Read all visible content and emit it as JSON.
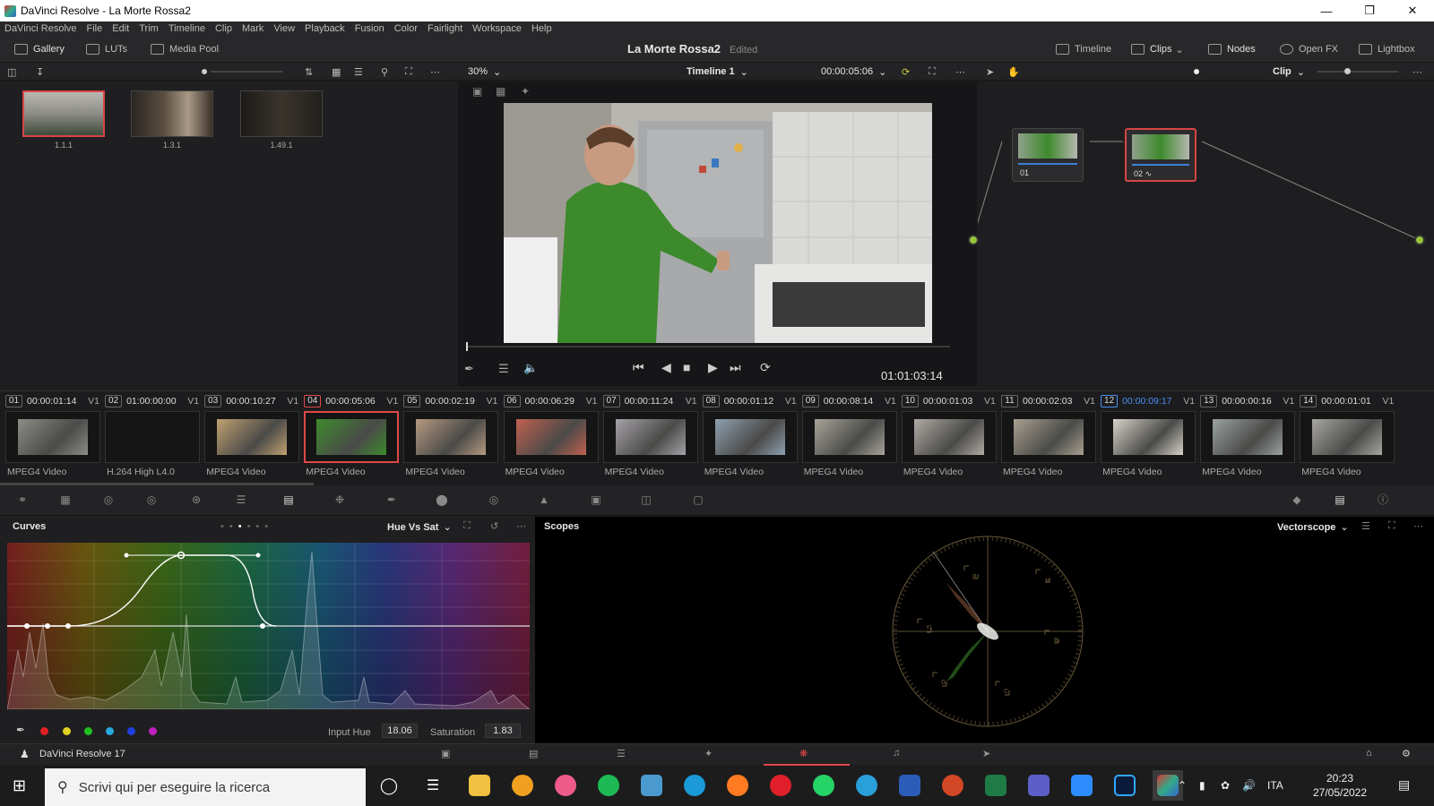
{
  "window": {
    "title": "DaVinci Resolve - La Morte Rossa2"
  },
  "menu": [
    "DaVinci Resolve",
    "File",
    "Edit",
    "Trim",
    "Timeline",
    "Clip",
    "Mark",
    "View",
    "Playback",
    "Fusion",
    "Color",
    "Fairlight",
    "Workspace",
    "Help"
  ],
  "toolbar": {
    "gallery": "Gallery",
    "luts": "LUTs",
    "media_pool": "Media Pool",
    "project_name": "La Morte Rossa2",
    "edited": "Edited",
    "timeline": "Timeline",
    "clips": "Clips",
    "nodes": "Nodes",
    "openfx": "Open FX",
    "lightbox": "Lightbox"
  },
  "viewer": {
    "zoom": "30%",
    "timeline_name": "Timeline 1",
    "timecode_top": "00:00:05:06",
    "timecode_main": "01:01:03:14",
    "node_mode": "Clip"
  },
  "gallery": {
    "stills": [
      {
        "label": "1.1.1",
        "selected": true
      },
      {
        "label": "1.3.1",
        "selected": false
      },
      {
        "label": "1.49.1",
        "selected": false
      }
    ]
  },
  "nodes": [
    {
      "label": "01"
    },
    {
      "label": "02"
    }
  ],
  "clips": [
    {
      "num": "01",
      "tc": "00:00:01:14",
      "track": "V1",
      "fmt": "MPEG4 Video"
    },
    {
      "num": "02",
      "tc": "01:00:00:00",
      "track": "V1",
      "fmt": "H.264 High L4.0"
    },
    {
      "num": "03",
      "tc": "00:00:10:27",
      "track": "V1",
      "fmt": "MPEG4 Video"
    },
    {
      "num": "04",
      "tc": "00:00:05:06",
      "track": "V1",
      "fmt": "MPEG4 Video",
      "active": true
    },
    {
      "num": "05",
      "tc": "00:00:02:19",
      "track": "V1",
      "fmt": "MPEG4 Video"
    },
    {
      "num": "06",
      "tc": "00:00:06:29",
      "track": "V1",
      "fmt": "MPEG4 Video"
    },
    {
      "num": "07",
      "tc": "00:00:11:24",
      "track": "V1",
      "fmt": "MPEG4 Video"
    },
    {
      "num": "08",
      "tc": "00:00:01:12",
      "track": "V1",
      "fmt": "MPEG4 Video"
    },
    {
      "num": "09",
      "tc": "00:00:08:14",
      "track": "V1",
      "fmt": "MPEG4 Video"
    },
    {
      "num": "10",
      "tc": "00:00:01:03",
      "track": "V1",
      "fmt": "MPEG4 Video"
    },
    {
      "num": "11",
      "tc": "00:00:02:03",
      "track": "V1",
      "fmt": "MPEG4 Video"
    },
    {
      "num": "12",
      "tc": "00:00:09:17",
      "track": "V1",
      "fmt": "MPEG4 Video",
      "blue": true
    },
    {
      "num": "13",
      "tc": "00:00:00:16",
      "track": "V1",
      "fmt": "MPEG4 Video"
    },
    {
      "num": "14",
      "tc": "00:00:01:01",
      "track": "V1",
      "fmt": "MPEG4 Video"
    }
  ],
  "curves": {
    "title": "Curves",
    "mode": "Hue Vs Sat",
    "input_hue_label": "Input Hue",
    "input_hue": "18.06",
    "saturation_label": "Saturation",
    "saturation": "1.83"
  },
  "scopes": {
    "title": "Scopes",
    "mode": "Vectorscope"
  },
  "pagebar": {
    "app": "DaVinci Resolve 17"
  },
  "taskbar": {
    "search_placeholder": "Scrivi qui per eseguire la ricerca",
    "lang": "ITA",
    "time": "20:23",
    "date": "27/05/2022"
  }
}
